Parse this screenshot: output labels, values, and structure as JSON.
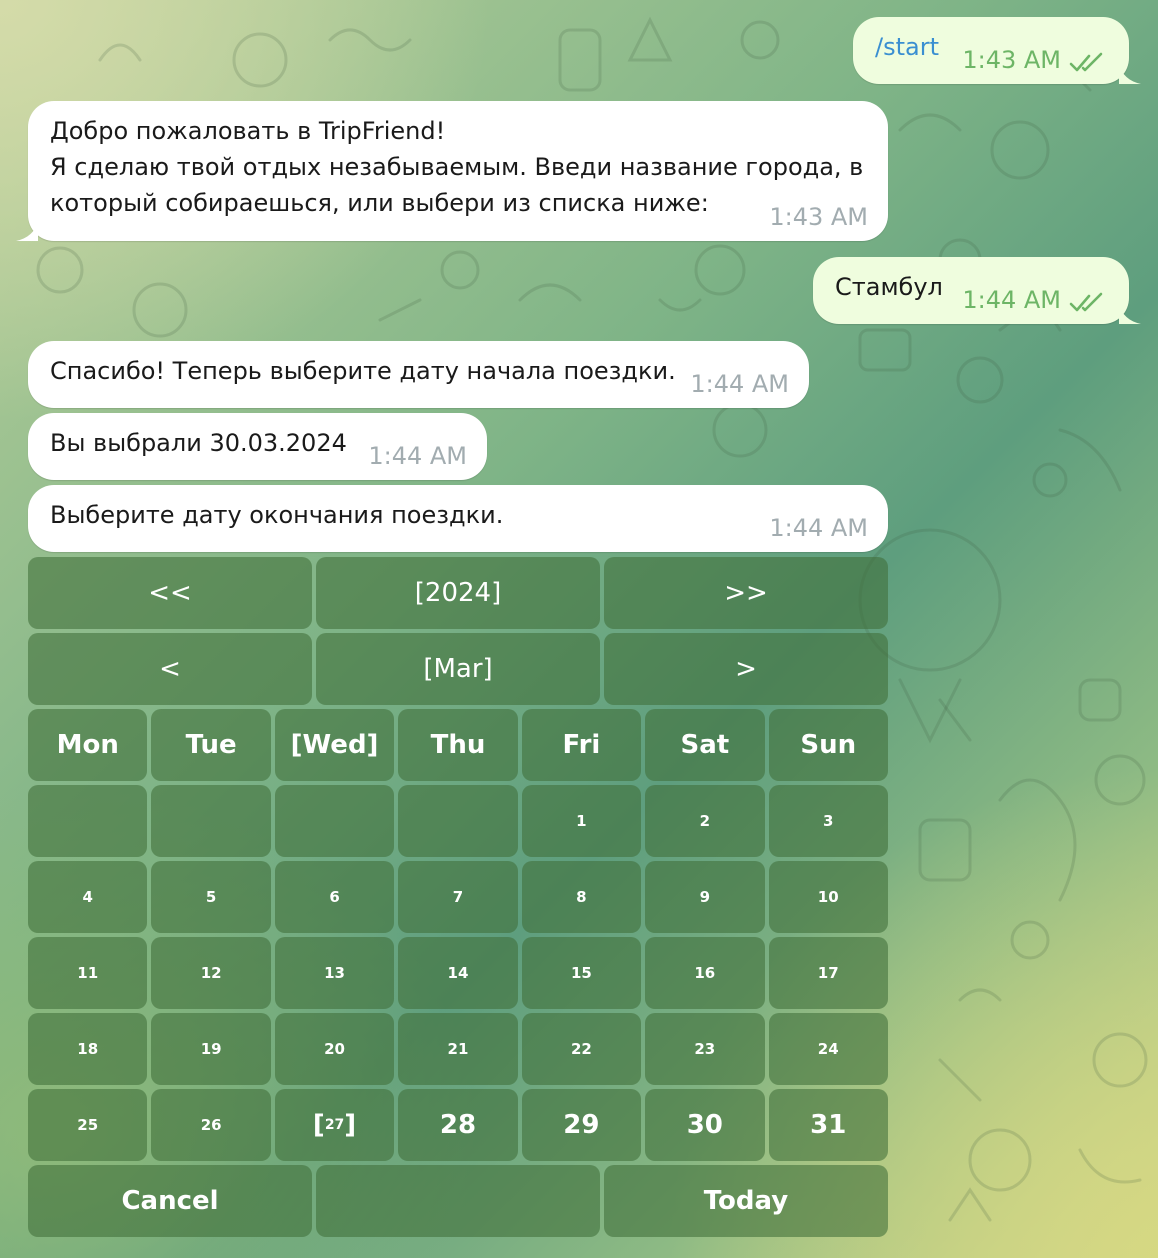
{
  "colors": {
    "incoming_bubble": "#ffffff",
    "outgoing_bubble": "#effdde",
    "outgoing_time": "#6db566",
    "incoming_time": "#a2acb0",
    "command_link": "#3a8fd1",
    "keyboard_button": "#4f7d47"
  },
  "messages": [
    {
      "direction": "out",
      "text": "/start",
      "time": "1:43 AM",
      "status": "read-double-check-icon"
    },
    {
      "direction": "in",
      "lines": [
        "Добро пожаловать в TripFriend!",
        "Я сделаю твой отдых незабываемым. Введи название города, в",
        "который собираешься, или выбери из списка ниже:"
      ],
      "time": "1:43 AM"
    },
    {
      "direction": "out",
      "text": "Стамбул",
      "time": "1:44 AM",
      "status": "read-double-check-icon"
    },
    {
      "direction": "in",
      "text": "Спасибо! Теперь выберите дату начала поездки.",
      "time": "1:44 AM"
    },
    {
      "direction": "in",
      "text": "Вы выбрали 30.03.2024",
      "time": "1:44 AM"
    },
    {
      "direction": "in",
      "text": "Выберите дату окончания поездки.",
      "time": "1:44 AM"
    }
  ],
  "keyboard": {
    "year_row": [
      "<<",
      "[2024]",
      ">>"
    ],
    "month_row": [
      "<",
      "[Mar]",
      ">"
    ],
    "weekdays": [
      "Mon",
      "Tue",
      "[Wed]",
      "Thu",
      "Fri",
      "Sat",
      "Sun"
    ],
    "weeks": [
      [
        "",
        "",
        "",
        "",
        "1",
        "2",
        "3"
      ],
      [
        "4",
        "5",
        "6",
        "7",
        "8",
        "9",
        "10"
      ],
      [
        "11",
        "12",
        "13",
        "14",
        "15",
        "16",
        "17"
      ],
      [
        "18",
        "19",
        "20",
        "21",
        "22",
        "23",
        "24"
      ]
    ],
    "last_week": {
      "d25": "25",
      "d26": "26",
      "d27": "27",
      "d28": "28",
      "d29": "29",
      "d30": "30",
      "d31": "31"
    },
    "bottom_row": [
      "Cancel",
      "",
      "Today"
    ]
  }
}
